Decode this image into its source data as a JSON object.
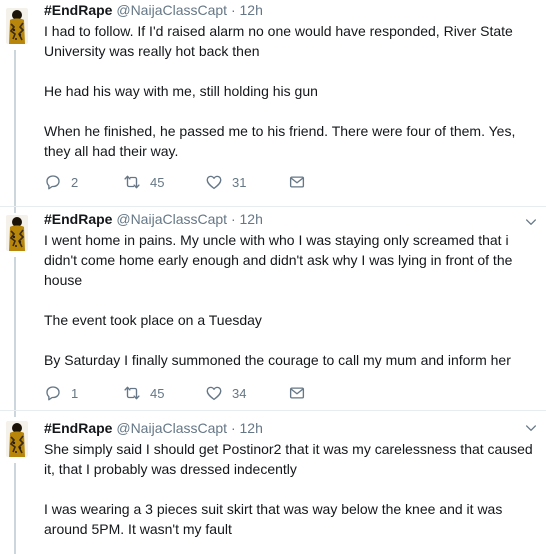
{
  "tweets": [
    {
      "name": "#EndRape",
      "handle": "@NaijaClassCapt",
      "time": "· 12h",
      "paragraphs": [
        "I had to follow. If I'd raised alarm no one would have responded, River State University was really hot back then",
        "He had his way with me, still holding his gun",
        "When he finished, he passed me to his friend. There were four of them. Yes, they all had their way."
      ],
      "replies": "2",
      "retweets": "45",
      "likes": "31"
    },
    {
      "name": "#EndRape",
      "handle": "@NaijaClassCapt",
      "time": "· 12h",
      "paragraphs": [
        "I went home in pains. My uncle with who I was staying only screamed that i didn't come home early enough and didn't ask why I was lying in front of the house",
        "The event took place on a Tuesday",
        "By Saturday I finally summoned the courage to call my mum and inform her"
      ],
      "replies": "1",
      "retweets": "45",
      "likes": "34"
    },
    {
      "name": "#EndRape",
      "handle": "@NaijaClassCapt",
      "time": "· 12h",
      "paragraphs": [
        "She simply said I should get Postinor2 that it was my carelessness that caused it, that I probably was dressed indecently",
        "I was wearing a 3 pieces suit skirt that was way below the knee and it was around 5PM. It wasn't my fault"
      ]
    }
  ],
  "icons": {
    "reply": "reply-icon",
    "retweet": "retweet-icon",
    "like": "heart-icon",
    "dm": "envelope-icon",
    "menu": "chevron-down-icon"
  },
  "colors": {
    "text": "#14171a",
    "secondary": "#657786",
    "thread_line": "#ccd6dd",
    "divider": "#e6ecf0"
  }
}
